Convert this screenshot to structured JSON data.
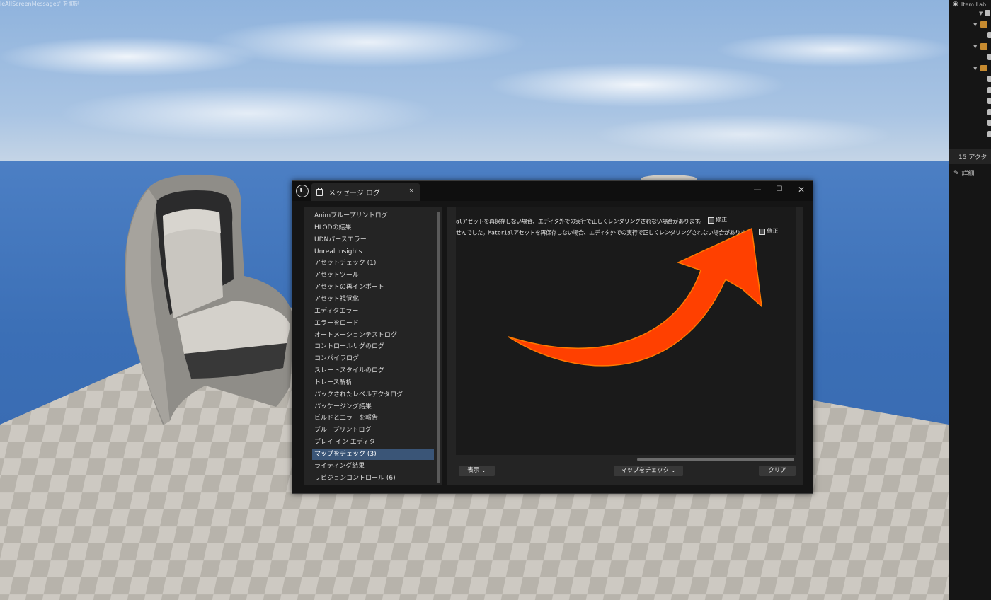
{
  "viewport": {
    "hint_text": "leAllScreenMessages' を抑制"
  },
  "outliner": {
    "header_label": "Item Lab",
    "actor_count": "15 アクタ",
    "details_tab": "詳細"
  },
  "window": {
    "tab_title": "メッセージ ログ",
    "tab_close": "×",
    "minimize": "—",
    "maximize": "☐",
    "close": "✕"
  },
  "categories": [
    "Animブループリントログ",
    "HLODの結果",
    "UDNパースエラー",
    "Unreal Insights",
    "アセットチェック (1)",
    "アセットツール",
    "アセットの再インポート",
    "アセット視覚化",
    "エディタエラー",
    "エラーをロード",
    "オートメーションテストログ",
    "コントロールリグのログ",
    "コンパイラログ",
    "スレートスタイルのログ",
    "トレース解析",
    "パックされたレベルアクタログ",
    "パッケージング結果",
    "ビルドとエラーを報告",
    "ブループリントログ",
    "プレイ イン エディタ",
    "マップをチェック (3)",
    "ライティング結果",
    "リビジョンコントロール (6)"
  ],
  "selected_category_index": 20,
  "log": {
    "lines": [
      {
        "text": "alアセットを再保存しない場合、エディタ外での実行で正しくレンダリングされない場合があります。",
        "fix": "修正"
      },
      {
        "text": "せんでした。Materialアセットを再保存しない場合、エディタ外での実行で正しくレンダリングされない場合があります。",
        "fix": "修正"
      }
    ]
  },
  "buttons": {
    "view": "表示",
    "check_map": "マップをチェック",
    "clear": "クリア"
  },
  "colors": {
    "annotation_arrow": "#ff4000",
    "selected_item": "#3a5577"
  }
}
